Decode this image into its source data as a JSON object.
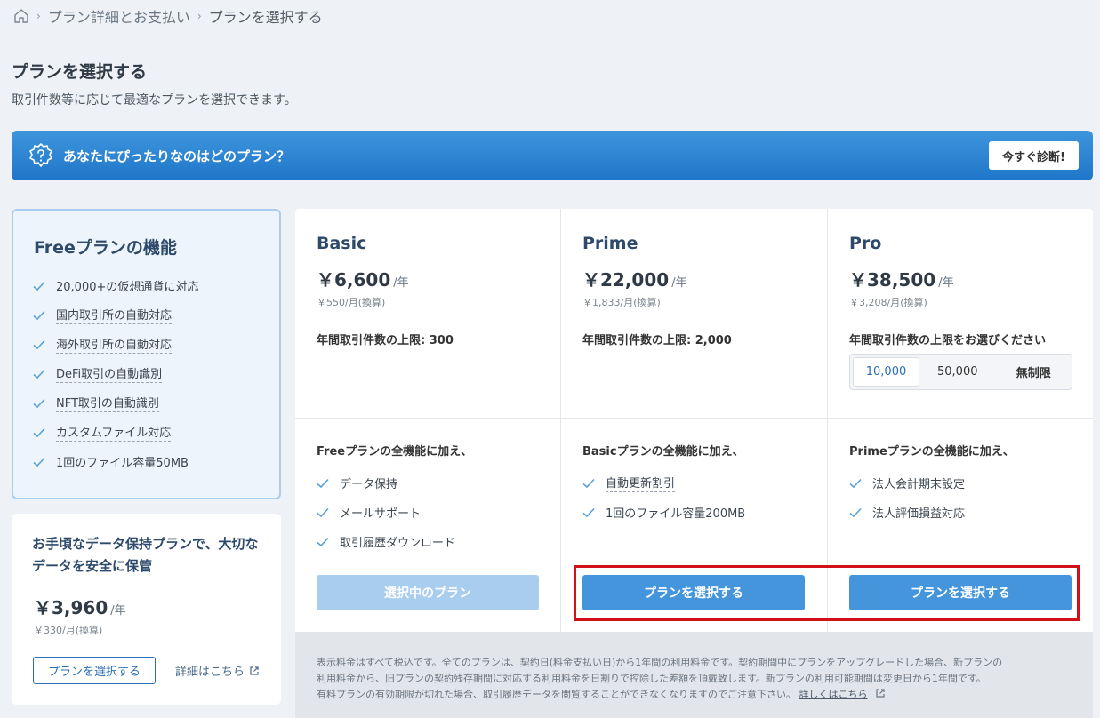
{
  "breadcrumb": {
    "items": [
      "プラン詳細とお支払い",
      "プランを選択する"
    ]
  },
  "page": {
    "title": "プランを選択する",
    "subtitle": "取引件数等に応じて最適なプランを選択できます。"
  },
  "banner": {
    "text": "あなたにぴったりなのはどのプラン？",
    "button": "今すぐ診断!"
  },
  "free_plan": {
    "title": "Freeプランの機能",
    "features": [
      "20,000+の仮想通貨に対応",
      "国内取引所の自動対応",
      "海外取引所の自動対応",
      "DeFi取引の自動識別",
      "NFT取引の自動識別",
      "カスタムファイル対応",
      "1回のファイル容量50MB"
    ]
  },
  "storage_plan": {
    "title": "お手頃なデータ保持プランで、大切なデータを安全に保管",
    "price": "￥3,960",
    "per_year": "/年",
    "monthly": "￥330/月(換算)",
    "button": "プランを選択する",
    "detail_link": "詳細はこちら"
  },
  "plans": [
    {
      "name": "Basic",
      "price": "￥6,600",
      "per_year": "/年",
      "monthly": "￥550/月(換算)",
      "limit": "年間取引件数の上限: 300",
      "feature_head": "Freeプランの全機能に加え、",
      "features": [
        "データ保持",
        "メールサポート",
        "取引履歴ダウンロード"
      ],
      "button": "選択中のプラン"
    },
    {
      "name": "Prime",
      "price": "￥22,000",
      "per_year": "/年",
      "monthly": "￥1,833/月(換算)",
      "limit": "年間取引件数の上限: 2,000",
      "feature_head": "Basicプランの全機能に加え、",
      "features": [
        "自動更新割引",
        "1回のファイル容量200MB"
      ],
      "button": "プランを選択する"
    },
    {
      "name": "Pro",
      "price": "￥38,500",
      "per_year": "/年",
      "monthly": "￥3,208/月(換算)",
      "limit": "年間取引件数の上限をお選びください",
      "limit_options": [
        "10,000",
        "50,000",
        "無制限"
      ],
      "selected_option": "10,000",
      "feature_head": "Primeプランの全機能に加え、",
      "features": [
        "法人会計期末設定",
        "法人評価損益対応"
      ],
      "button": "プランを選択する"
    }
  ],
  "notes": {
    "line1": "表示料金はすべて税込です。全てのプランは、契約日(料金支払い日)から1年間の利用料金です。契約期間中にプランをアップグレードした場合、新プランの",
    "line2": "利用料金から、旧プランの契約残存期間に対応する利用料金を日割りで控除した差額を頂戴致します。新プランの利用可能期間は変更日から1年間です。",
    "line3": "有料プランの有効期限が切れた場合、取引履歴データを閲覧することができなくなりますのでご注意下さい。",
    "link": "詳しくはこちら"
  },
  "colors": {
    "accent": "#4595dd",
    "banner": "#2a84d2",
    "highlight": "#d2101a"
  }
}
